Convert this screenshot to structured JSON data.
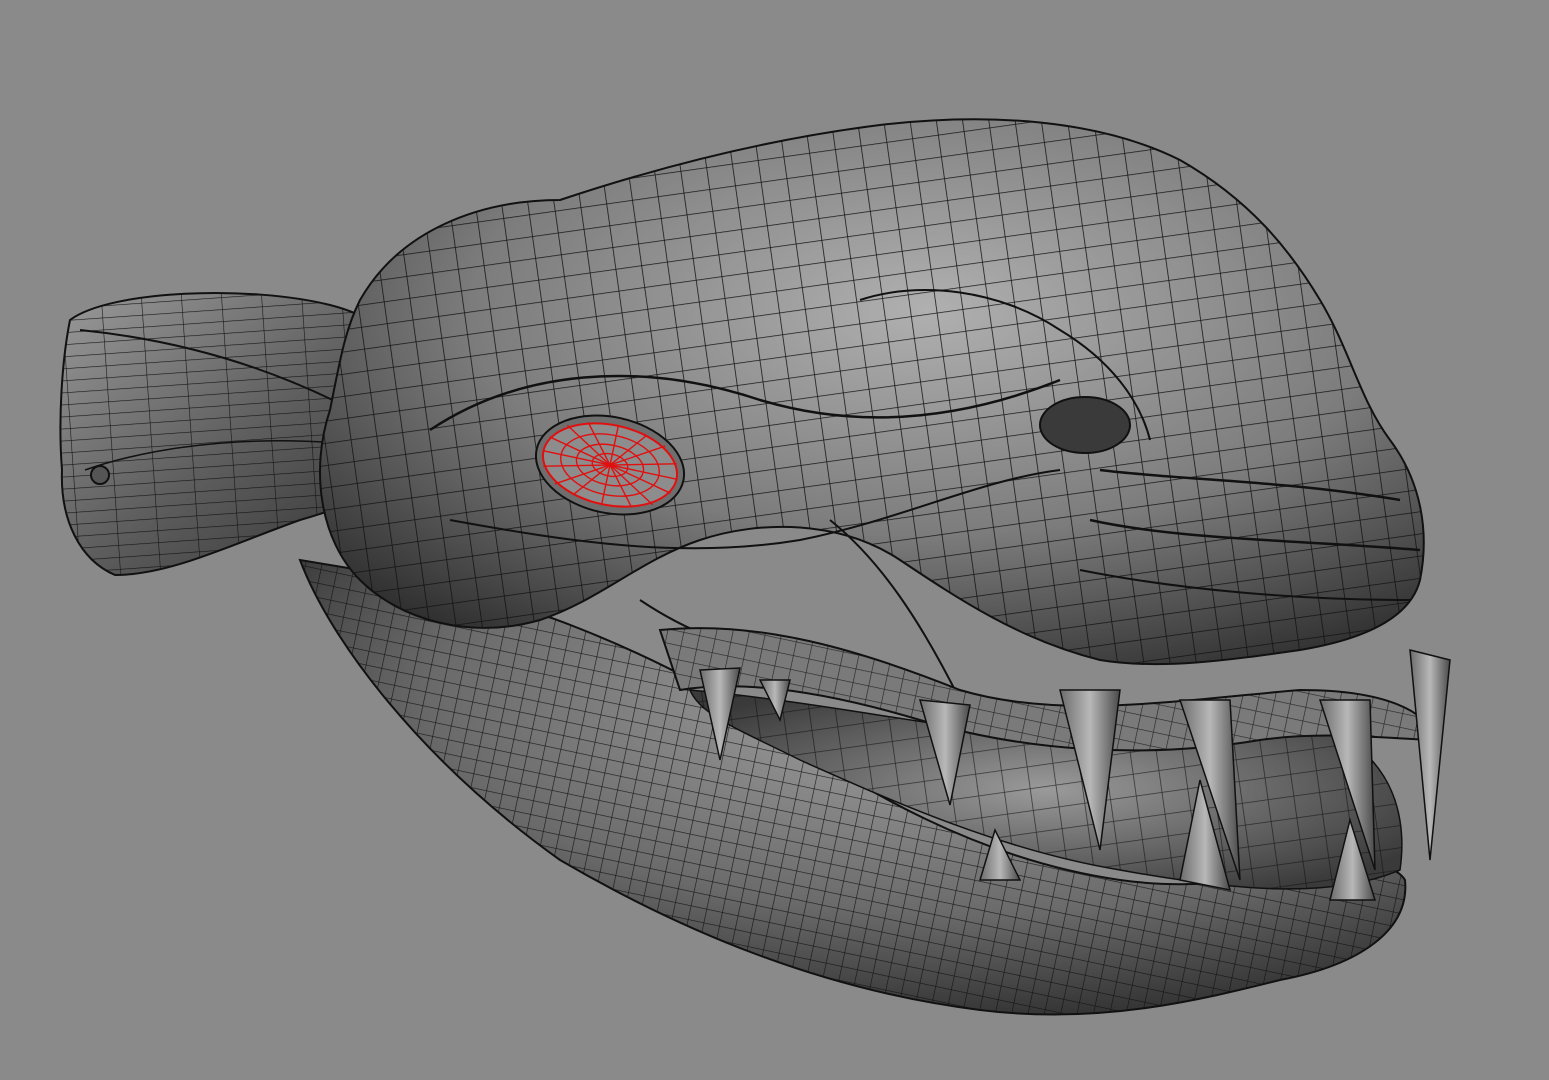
{
  "viewport": {
    "background_color": "#8a8a8a",
    "mesh_color": "#7a7a7a",
    "wire_color": "#111111",
    "selection_color": "#e01010",
    "model": "creature-head-wireframe-mesh",
    "shading": "smooth-shaded-with-wireframe",
    "selected_component": "eye-mesh-selected"
  }
}
